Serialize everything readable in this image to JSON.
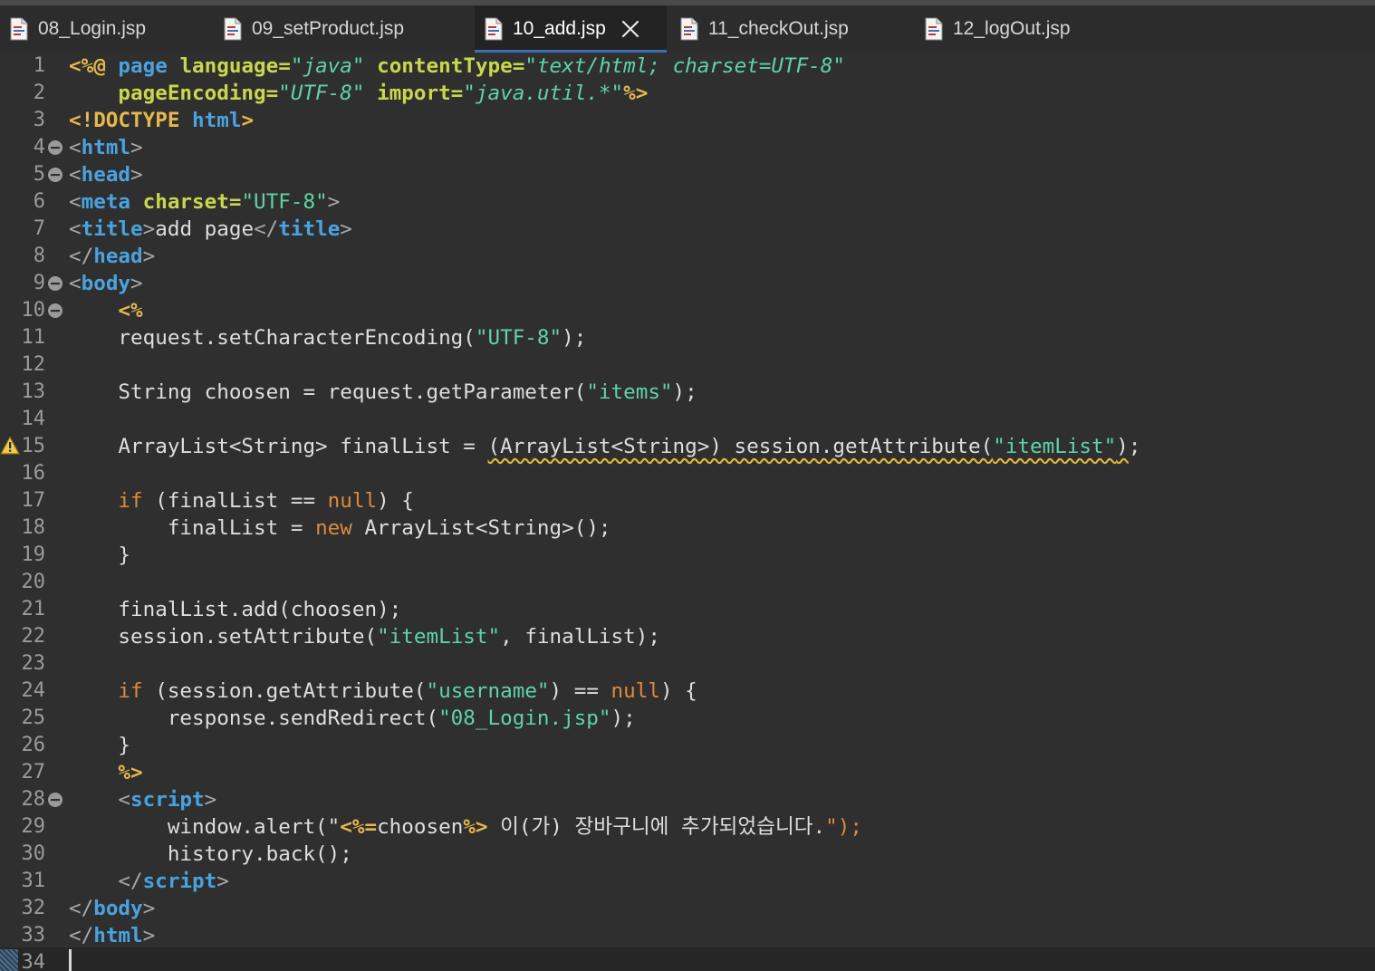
{
  "tabs": [
    {
      "label": "08_Login.jsp",
      "active": false
    },
    {
      "label": "09_setProduct.jsp",
      "active": false
    },
    {
      "label": "10_add.jsp",
      "active": true
    },
    {
      "label": "11_checkOut.jsp",
      "active": false
    },
    {
      "label": "12_logOut.jsp",
      "active": false
    }
  ],
  "colors": {
    "background": "#2f2f2f",
    "keyword": "#e6b84c",
    "tag": "#4aa3df",
    "attribute": "#c8d84c",
    "string": "#5fd3a8",
    "java_keyword": "#dd8a3e",
    "plain": "#dedede",
    "punct": "#a8a8a8",
    "line_number": "#9a9a9a",
    "warning": "#e0b43a",
    "active_tab_indicator": "#3d6fb0"
  },
  "gutter": {
    "fold_lines": [
      4,
      5,
      9,
      10,
      28
    ],
    "warning_line": 15,
    "current_line": 34
  },
  "code": [
    [
      [
        "k",
        "<%@ "
      ],
      [
        "t",
        "page "
      ],
      [
        "a",
        "language="
      ],
      [
        "s",
        "\"java\""
      ],
      [
        "a",
        " contentType="
      ],
      [
        "s",
        "\"text/html; charset=UTF-8\""
      ]
    ],
    [
      [
        "a",
        "    pageEncoding="
      ],
      [
        "s",
        "\"UTF-8\""
      ],
      [
        "a",
        " import="
      ],
      [
        "s",
        "\"java.util.*\""
      ],
      [
        "k",
        "%>"
      ]
    ],
    [
      [
        "k",
        "<!DOCTYPE "
      ],
      [
        "t",
        "html"
      ],
      [
        "k",
        ">"
      ]
    ],
    [
      [
        "p",
        "<"
      ],
      [
        "t",
        "html"
      ],
      [
        "p",
        ">"
      ]
    ],
    [
      [
        "p",
        "<"
      ],
      [
        "t",
        "head"
      ],
      [
        "p",
        ">"
      ]
    ],
    [
      [
        "p",
        "<"
      ],
      [
        "t",
        "meta "
      ],
      [
        "a",
        "charset="
      ],
      [
        "s",
        "\"UTF-8\""
      ],
      [
        "p",
        ">"
      ]
    ],
    [
      [
        "p",
        "<"
      ],
      [
        "t",
        "title"
      ],
      [
        "p",
        ">"
      ],
      [
        "n",
        "add page"
      ],
      [
        "p",
        "</"
      ],
      [
        "t",
        "title"
      ],
      [
        "p",
        ">"
      ]
    ],
    [
      [
        "p",
        "</"
      ],
      [
        "t",
        "head"
      ],
      [
        "p",
        ">"
      ]
    ],
    [
      [
        "p",
        "<"
      ],
      [
        "t",
        "body"
      ],
      [
        "p",
        ">"
      ]
    ],
    [
      [
        "k",
        "    <%"
      ]
    ],
    [
      [
        "n",
        "    request.setCharacterEncoding("
      ],
      [
        "s",
        "\"UTF-8\""
      ],
      [
        "n",
        ");"
      ]
    ],
    [],
    [
      [
        "n",
        "    String choosen = request.getParameter("
      ],
      [
        "s",
        "\"items\""
      ],
      [
        "n",
        ");"
      ]
    ],
    [],
    [
      [
        "n",
        "    ArrayList<String> finalList = "
      ],
      [
        "wn",
        "(ArrayList<String>) session.getAttribute("
      ],
      [
        "ws",
        "\"itemList\""
      ],
      [
        "wn",
        ")"
      ],
      [
        "n",
        ";"
      ]
    ],
    [],
    [
      [
        "j",
        "    if"
      ],
      [
        "n",
        " (finalList == "
      ],
      [
        "j",
        "null"
      ],
      [
        "n",
        ") {"
      ]
    ],
    [
      [
        "n",
        "        finalList = "
      ],
      [
        "j",
        "new"
      ],
      [
        "n",
        " ArrayList<String>();"
      ]
    ],
    [
      [
        "n",
        "    }"
      ]
    ],
    [],
    [
      [
        "n",
        "    finalList.add(choosen);"
      ]
    ],
    [
      [
        "n",
        "    session.setAttribute("
      ],
      [
        "s",
        "\"itemList\""
      ],
      [
        "n",
        ", finalList);"
      ]
    ],
    [],
    [
      [
        "j",
        "    if"
      ],
      [
        "n",
        " (session.getAttribute("
      ],
      [
        "s",
        "\"username\""
      ],
      [
        "n",
        ") == "
      ],
      [
        "j",
        "null"
      ],
      [
        "n",
        ") {"
      ]
    ],
    [
      [
        "n",
        "        response.sendRedirect("
      ],
      [
        "s",
        "\"08_Login.jsp\""
      ],
      [
        "n",
        ");"
      ]
    ],
    [
      [
        "n",
        "    }"
      ]
    ],
    [
      [
        "k",
        "    %>"
      ]
    ],
    [
      [
        "p",
        "    <"
      ],
      [
        "t",
        "script"
      ],
      [
        "p",
        ">"
      ]
    ],
    [
      [
        "n",
        "        window.alert(\""
      ],
      [
        "k",
        "<%="
      ],
      [
        "n",
        "choosen"
      ],
      [
        "k",
        "%>"
      ],
      [
        "n",
        " 이(가) 장바구니에 추가되었습니다."
      ],
      [
        "j",
        "\");"
      ]
    ],
    [
      [
        "n",
        "        history.back();"
      ]
    ],
    [
      [
        "p",
        "    </"
      ],
      [
        "t",
        "script"
      ],
      [
        "p",
        ">"
      ]
    ],
    [
      [
        "p",
        "</"
      ],
      [
        "t",
        "body"
      ],
      [
        "p",
        ">"
      ]
    ],
    [
      [
        "p",
        "</"
      ],
      [
        "t",
        "html"
      ],
      [
        "p",
        ">"
      ]
    ],
    []
  ]
}
